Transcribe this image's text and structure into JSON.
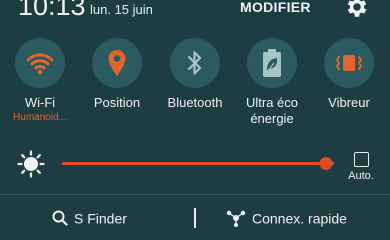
{
  "status": {
    "time": "10:13",
    "date": "lun. 15 juin",
    "edit_label": "MODIFIER"
  },
  "colors": {
    "background": "#1d3d43",
    "tile_circle": "#2b5a61",
    "accent_active": "#e1662b",
    "icon_inactive": "#aac4c6"
  },
  "tiles": [
    {
      "label": "Wi-Fi",
      "sublabel": "Humanoid...",
      "icon": "wifi-icon",
      "active": true
    },
    {
      "label": "Position",
      "sublabel": "",
      "icon": "location-pin-icon",
      "active": true
    },
    {
      "label": "Bluetooth",
      "sublabel": "",
      "icon": "bluetooth-icon",
      "active": false
    },
    {
      "label": "Ultra éco énergie",
      "sublabel": "",
      "icon": "eco-battery-icon",
      "active": false
    },
    {
      "label": "Vibreur",
      "sublabel": "",
      "icon": "vibrate-icon",
      "active": true
    }
  ],
  "brightness": {
    "level": 0.97,
    "auto_label": "Auto."
  },
  "bottom": {
    "sfinder_label": "S Finder",
    "quick_connect_label": "Connex. rapide"
  }
}
